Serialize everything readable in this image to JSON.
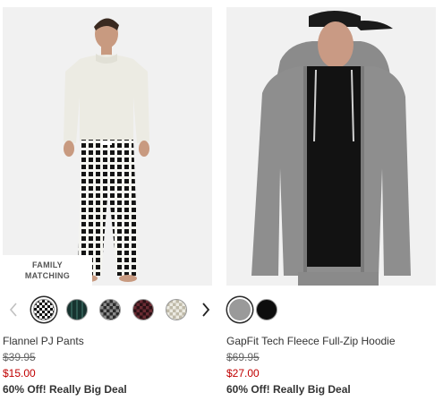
{
  "products": [
    {
      "name": "Flannel PJ Pants",
      "original_price": "$39.95",
      "sale_price": "$15.00",
      "promo": "60% Off! Really Big Deal",
      "badge": [
        "FAMILY",
        "MATCHING"
      ],
      "image_icon": "model-photo",
      "prev_arrow_icon": "chevron-left-icon",
      "next_arrow_icon": "chevron-right-icon",
      "swatches": [
        {
          "label": "black-white-check",
          "color": "#1a1a1a",
          "selected": true
        },
        {
          "label": "green-plaid",
          "color": "#1f3d3a",
          "selected": false
        },
        {
          "label": "grey-plaid",
          "color": "#555555",
          "selected": false
        },
        {
          "label": "red-plaid",
          "color": "#3a1a1e",
          "selected": false
        },
        {
          "label": "cream-plaid",
          "color": "#d8d4c4",
          "selected": false
        }
      ]
    },
    {
      "name": "GapFit Tech Fleece Full-Zip Hoodie",
      "original_price": "$69.95",
      "sale_price": "$27.00",
      "promo": "60% Off! Really Big Deal",
      "image_icon": "model-photo",
      "swatches": [
        {
          "label": "heather-grey",
          "color": "#9a9a9a",
          "selected": true
        },
        {
          "label": "black",
          "color": "#0d0d0d",
          "selected": false
        }
      ]
    }
  ],
  "colors": {
    "sale": "#c00000",
    "text": "#333333"
  }
}
